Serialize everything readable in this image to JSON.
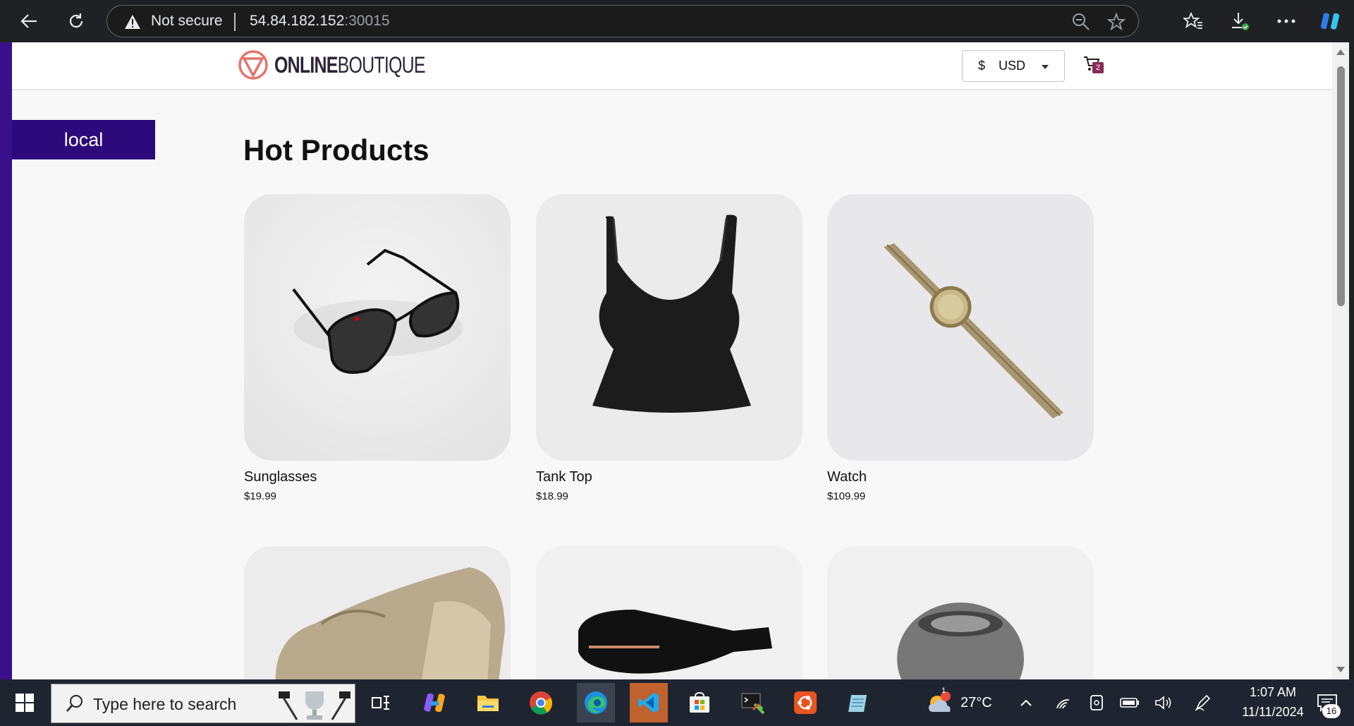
{
  "browser": {
    "security_text": "Not secure",
    "url_host": "54.84.182.152",
    "url_port": ":30015"
  },
  "store": {
    "logo_bold": "ONLINE",
    "logo_light": "BOUTIQUE",
    "currency_symbol": "$",
    "currency_code": "USD",
    "cart_count": "2"
  },
  "env_label": "local",
  "section_title": "Hot Products",
  "products": [
    {
      "name": "Sunglasses",
      "price": "$19.99"
    },
    {
      "name": "Tank Top",
      "price": "$18.99"
    },
    {
      "name": "Watch",
      "price": "$109.99"
    }
  ],
  "taskbar": {
    "search_placeholder": "Type here to search",
    "weather_badge": "1",
    "temperature": "27°C",
    "time": "1:07 AM",
    "date": "11/11/2024",
    "notification_count": "16"
  },
  "colors": {
    "brand": "#2d0a7b",
    "logo_red": "#e5736d",
    "cart_badge": "#8a2a57"
  }
}
